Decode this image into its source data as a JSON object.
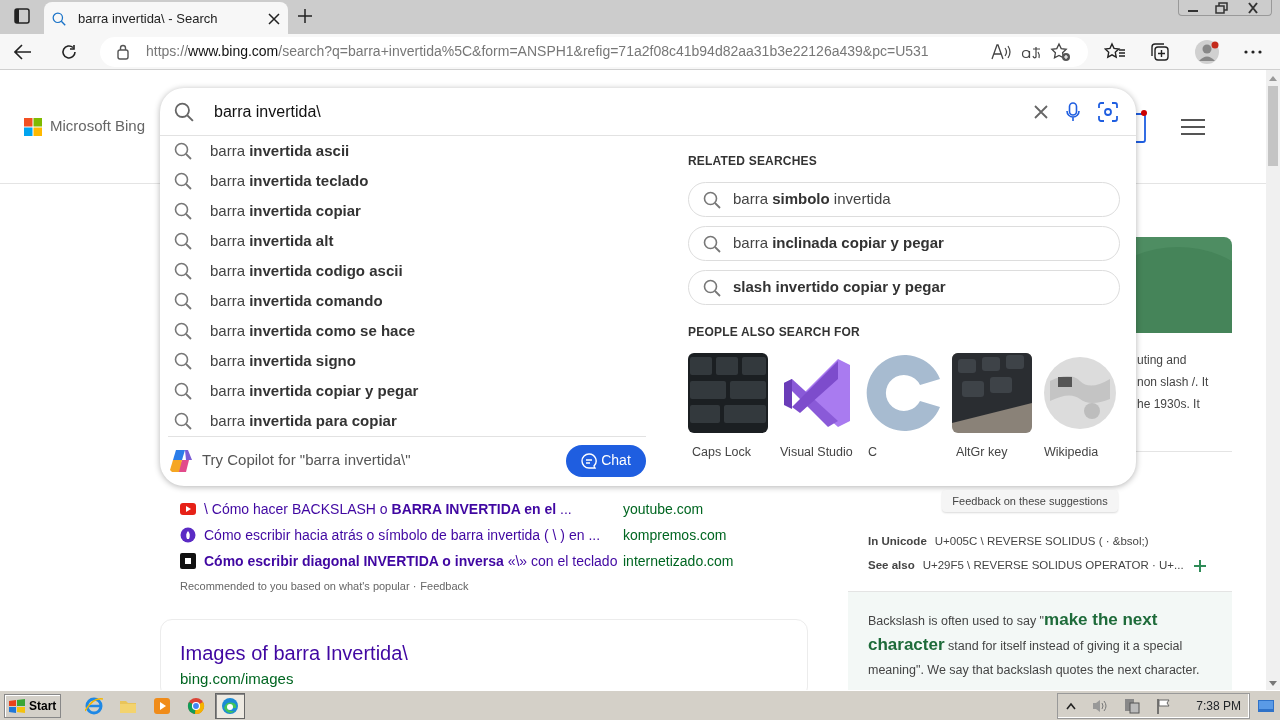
{
  "browser": {
    "tab": {
      "title": "barra invertida\\ - Search"
    },
    "url": {
      "scheme": "https://",
      "host": "www.bing.com",
      "path": "/search?q=barra+invertida%5C&form=ANSPH1&refig=71a2f08c41b94d82aa31b3e22126a439&pc=U531"
    }
  },
  "header": {
    "logo": "Microsoft Bing",
    "notification": true
  },
  "search": {
    "value": "barra invertida\\"
  },
  "suggestions": [
    {
      "text": "barra **invertida ascii**"
    },
    {
      "text": "barra **invertida teclado**"
    },
    {
      "text": "barra **invertida copiar**"
    },
    {
      "text": "barra **invertida alt**"
    },
    {
      "text": "barra **invertida codigo ascii**"
    },
    {
      "text": "barra **invertida comando**"
    },
    {
      "text": "barra **invertida como se hace**"
    },
    {
      "text": "barra **invertida signo**"
    },
    {
      "text": "barra **invertida copiar y pegar**"
    },
    {
      "text": "barra **invertida para copiar**"
    }
  ],
  "copilot": {
    "text": "Try Copilot for \"barra invertida\\\"",
    "button": "Chat"
  },
  "related_searches": {
    "title": "RELATED SEARCHES",
    "items": [
      {
        "text": "barra **simbolo** invertida"
      },
      {
        "text": "barra **inclinada copiar y pegar**"
      },
      {
        "text": "**slash invertido copiar y pegar**"
      }
    ]
  },
  "people_also_search": {
    "title": "PEOPLE ALSO SEARCH FOR",
    "items": [
      {
        "label": "Caps Lock",
        "kind": "picture"
      },
      {
        "label": "Visual Studio",
        "kind": "picture"
      },
      {
        "label": "C",
        "kind": "picture"
      },
      {
        "label": "AltGr key",
        "kind": "picture"
      },
      {
        "label": "Wikipedia",
        "kind": "picture"
      }
    ]
  },
  "results": [
    {
      "title": "\\ Cómo hacer BACKSLASH o **BARRA INVERTIDA en el** ...",
      "source": "youtube.com",
      "kind": "video"
    },
    {
      "title": "Cómo escribir hacia atrás o símbolo de barra invertida ( \\ ) en ...",
      "source": "kompremos.com",
      "kind": "circle"
    },
    {
      "title": "**Cómo escribir diagonal INVERTIDA o inversa** «\\» con el teclado",
      "source": "internetizado.com",
      "kind": "square"
    }
  ],
  "recommended": {
    "text": "Recommended to you based on what's popular ·",
    "link": "Feedback"
  },
  "images": {
    "title": "Images of barra Invertida\\",
    "url": "bing.com/images"
  },
  "knowledge": {
    "fragments": [
      "uting and",
      "non slash /. It",
      "he 1930s. It"
    ],
    "facts": [
      {
        "label": "In Unicode",
        "value": "U+005C \\ REVERSE SOLIDUS ( · &bsol;)",
        "expandable": false
      },
      {
        "label": "See also",
        "value": "U+29F5 \\ REVERSE SOLIDUS OPERATOR · U+...",
        "expandable": true
      }
    ],
    "quote": "Backslash is often used to say \"**make the next character** stand for itself instead of giving it a special meaning\". We say that backslash quotes the next character."
  },
  "feedback_tooltip": "Feedback on these suggestions",
  "taskbar": {
    "start": "Start",
    "clock": "7:38 PM",
    "apps": [
      {
        "kind": "ie",
        "selected": false
      },
      {
        "kind": "folder",
        "selected": false
      },
      {
        "kind": "media",
        "selected": false
      },
      {
        "kind": "chrome",
        "selected": false
      },
      {
        "kind": "edge",
        "selected": true
      }
    ]
  }
}
